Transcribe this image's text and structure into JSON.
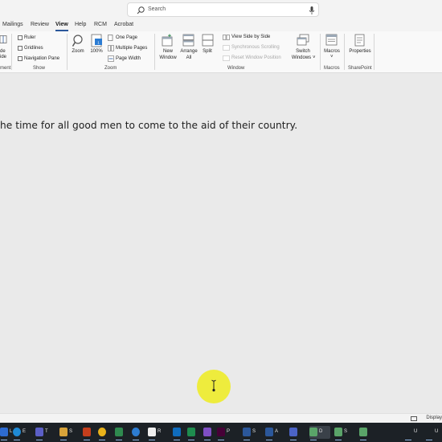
{
  "titlebar": {
    "search_placeholder": "Search"
  },
  "tabs": [
    {
      "label": "Mailings"
    },
    {
      "label": "Review"
    },
    {
      "label": "View",
      "active": true
    },
    {
      "label": "Help"
    },
    {
      "label": "RCM"
    },
    {
      "label": "Acrobat"
    }
  ],
  "ribbon": {
    "partial": {
      "line1": "de",
      "line2": "ide",
      "group_fragment": "ment"
    },
    "show": {
      "ruler": "Ruler",
      "gridlines": "Gridlines",
      "navigation_pane": "Navigation Pane",
      "group": "Show"
    },
    "zoom": {
      "zoom": "Zoom",
      "hundred": "100%",
      "one_page": "One Page",
      "multiple_pages": "Multiple Pages",
      "page_width": "Page Width",
      "group": "Zoom"
    },
    "window": {
      "new_window_1": "New",
      "new_window_2": "Window",
      "arrange_all_1": "Arrange",
      "arrange_all_2": "All",
      "split": "Split",
      "view_side_by_side": "View Side by Side",
      "synchronous_scrolling": "Synchronous Scrolling",
      "reset_window_position": "Reset Window Position",
      "switch_windows_1": "Switch",
      "switch_windows_2": "Windows",
      "group": "Window"
    },
    "macros": {
      "label": "Macros",
      "group": "Macros"
    },
    "sharepoint": {
      "label": "Properties",
      "group": "SharePoint"
    }
  },
  "document": {
    "text": "he time for all good men to come to the aid of their country."
  },
  "statusbar": {
    "display": "Display"
  },
  "taskbar": [
    {
      "label": "L",
      "color": "#2d6bd1"
    },
    {
      "label": "E",
      "color": "#1f8ad6"
    },
    {
      "label": "T",
      "color": "#5b5fc7"
    },
    {
      "label": "S",
      "color": "#d8a33a"
    },
    {
      "label": "",
      "color": "#c43e1c"
    },
    {
      "label": "",
      "color": "#e8b21b"
    },
    {
      "label": "R",
      "color": "#2f8a4f"
    },
    {
      "label": "",
      "color": "#2d7dd2"
    },
    {
      "label": "",
      "color": "#eeeeee"
    },
    {
      "label": "",
      "color": "#0f6cbd"
    },
    {
      "label": "P",
      "color": "#1e8c4e"
    },
    {
      "label": "S",
      "color": "#7f4fc4"
    },
    {
      "label": "A",
      "color": "#470137"
    },
    {
      "label": "",
      "color": "#2b579a"
    },
    {
      "label": "D",
      "color": "#2b579a"
    },
    {
      "label": "S",
      "color": "#4b63c6"
    },
    {
      "label": "",
      "color": "#5aa469"
    },
    {
      "label": "U",
      "color": "#5aa469"
    },
    {
      "label": "U",
      "color": "#5aa469"
    }
  ]
}
